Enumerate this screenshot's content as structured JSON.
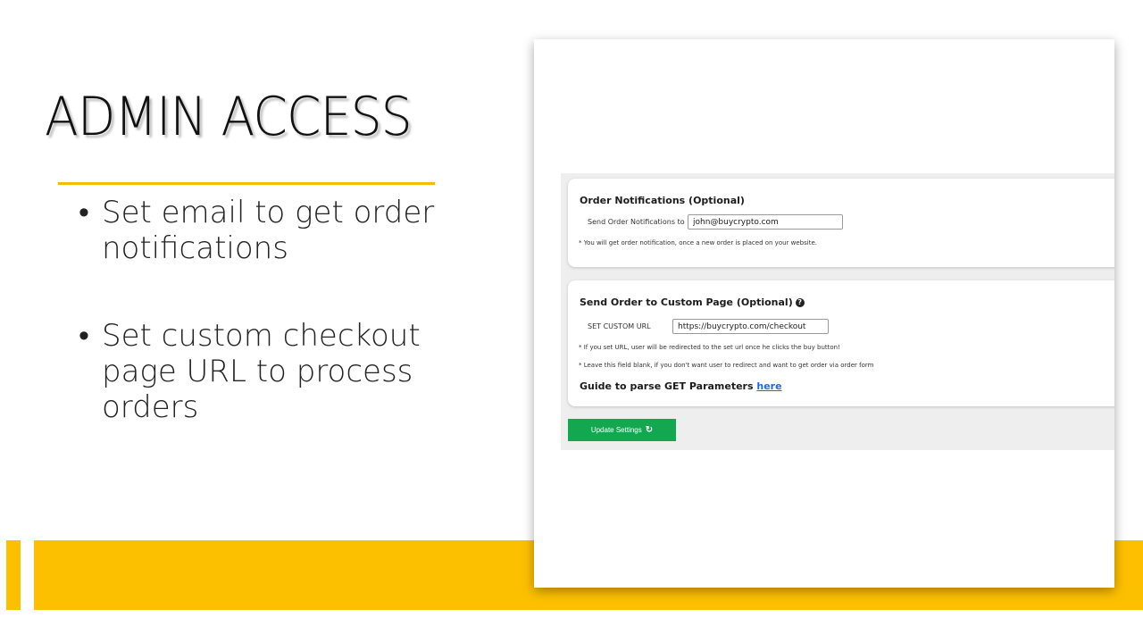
{
  "slide": {
    "title": "ADMIN ACCESS",
    "bullets": [
      {
        "marker": "•",
        "text": "Set email to get order notifications"
      },
      {
        "marker": "•",
        "text": "Set custom checkout page URL to  process orders"
      }
    ],
    "accent_color": "#fdc000"
  },
  "screenshot": {
    "notifications_panel": {
      "title": "Order Notifications (Optional)",
      "field_label": "Send Order Notifications to",
      "email_value": "john@buycrypto.com",
      "note": "* You will get order notification, once a new order is placed on your website."
    },
    "custom_page_panel": {
      "title": "Send Order to Custom Page (Optional)",
      "help_icon": "?",
      "field_label": "SET CUSTOM URL",
      "url_value": "https://buycrypto.com/checkout",
      "note_1": "* If you set URL, user will be redirected to the set url once he clicks the buy button!",
      "note_2": "* Leave this field blank, if you don't want user to redirect and want to get order via order form",
      "guide_text": "Guide to parse GET Parameters",
      "guide_link": "here"
    },
    "update_button": {
      "label": "Update Settings",
      "icon": "refresh-icon",
      "color": "#13a84f"
    }
  }
}
